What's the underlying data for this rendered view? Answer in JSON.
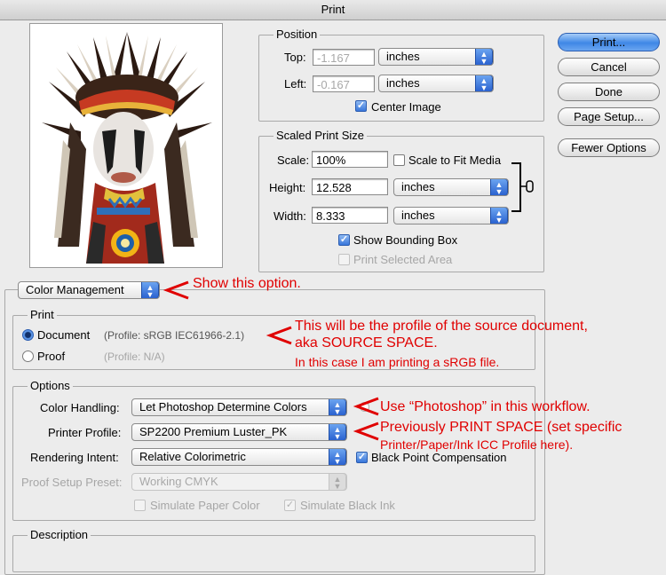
{
  "window": {
    "title": "Print"
  },
  "buttons": {
    "print": "Print...",
    "cancel": "Cancel",
    "done": "Done",
    "page_setup": "Page Setup...",
    "fewer_options": "Fewer Options"
  },
  "position": {
    "legend": "Position",
    "top_label": "Top:",
    "top_value": "-1.167",
    "top_unit": "inches",
    "left_label": "Left:",
    "left_value": "-0.167",
    "left_unit": "inches",
    "center_image_label": "Center Image",
    "center_image_checked": true
  },
  "scaled": {
    "legend": "Scaled Print Size",
    "scale_label": "Scale:",
    "scale_value": "100%",
    "scale_to_fit_label": "Scale to Fit Media",
    "height_label": "Height:",
    "height_value": "12.528",
    "height_unit": "inches",
    "width_label": "Width:",
    "width_value": "8.333",
    "width_unit": "inches",
    "show_bbox_label": "Show Bounding Box",
    "print_selected_label": "Print Selected Area"
  },
  "color_mgmt_popup": "Color Management",
  "print_group": {
    "legend": "Print",
    "document_label": "Document",
    "document_profile": "(Profile: sRGB IEC61966-2.1)",
    "proof_label": "Proof",
    "proof_profile": "(Profile: N/A)"
  },
  "options": {
    "legend": "Options",
    "color_handling_label": "Color Handling:",
    "color_handling_value": "Let Photoshop Determine Colors",
    "printer_profile_label": "Printer Profile:",
    "printer_profile_value": "SP2200 Premium Luster_PK",
    "rendering_intent_label": "Rendering Intent:",
    "rendering_intent_value": "Relative Colorimetric",
    "black_point_label": "Black Point Compensation",
    "proof_setup_label": "Proof Setup Preset:",
    "proof_setup_value": "Working CMYK",
    "simulate_paper_label": "Simulate Paper Color",
    "simulate_black_label": "Simulate Black Ink"
  },
  "description": {
    "legend": "Description"
  },
  "annotations": {
    "show_option": "Show this option.",
    "source_line1": "This will be the profile of the source document,",
    "source_line2": "aka SOURCE SPACE.",
    "source_line3": "In this case I am printing a sRGB file.",
    "photoshop": "Use “Photoshop” in this workflow.",
    "print_space_line1": "Previously PRINT SPACE (set specific",
    "print_space_line2": "Printer/Paper/Ink ICC Profile here).",
    "accent_color": "#e00000"
  }
}
